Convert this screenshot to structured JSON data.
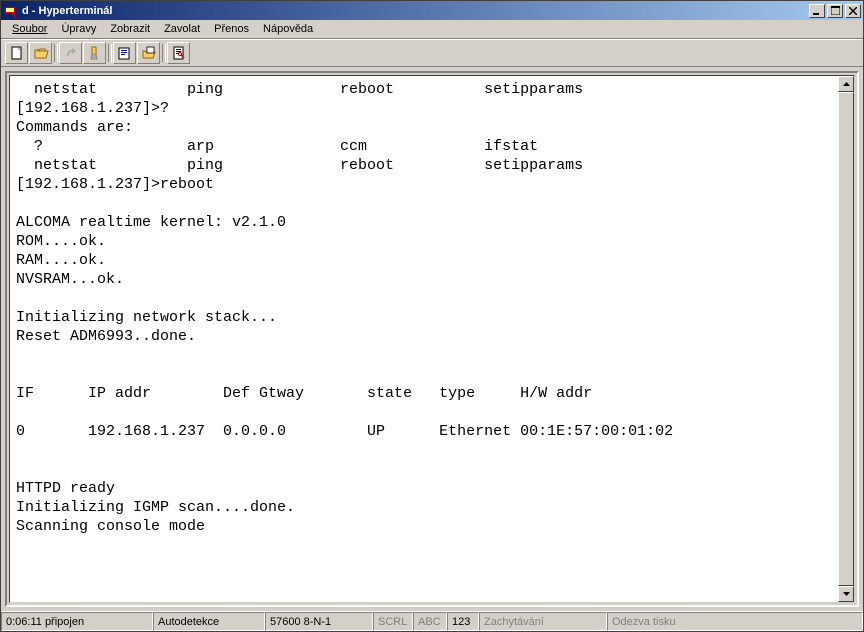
{
  "window": {
    "title": "d - Hyperterminál"
  },
  "menu": {
    "items": [
      "Soubor",
      "Úpravy",
      "Zobrazit",
      "Zavolat",
      "Přenos",
      "Nápověda"
    ]
  },
  "terminal": {
    "text": "  netstat          ping             reboot          setipparams\n[192.168.1.237]>?\nCommands are:\n  ?                arp              ccm             ifstat\n  netstat          ping             reboot          setipparams\n[192.168.1.237]>reboot\n\nALCOMA realtime kernel: v2.1.0\nROM....ok.\nRAM....ok.\nNVSRAM...ok.\n\nInitializing network stack...\nReset ADM6993..done.\n\n\nIF      IP addr        Def Gtway       state   type     H/W addr\n\n0       192.168.1.237  0.0.0.0         UP      Ethernet 00:1E:57:00:01:02\n\n\nHTTPD ready\nInitializing IGMP scan....done.\nScanning console mode"
  },
  "status": {
    "time_connected": "0:06:11 připojen",
    "detect": "Autodetekce",
    "params": "57600 8-N-1",
    "scrl": "SCRL",
    "abc": "ABC",
    "num": "123",
    "capture": "Zachytávání",
    "echo": "Odezva tisku"
  }
}
